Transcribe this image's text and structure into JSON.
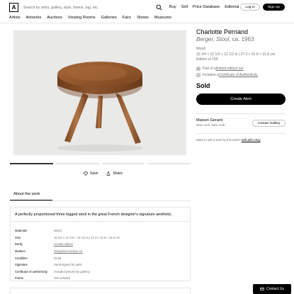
{
  "header": {
    "logo": "A",
    "search_placeholder": "Search by artist, gallery, style, theme, tag, etc.",
    "links": [
      "Buy",
      "Sell",
      "Price Database",
      "Editorial"
    ],
    "login": "Log In",
    "signup": "Sign Up"
  },
  "nav": [
    "Artists",
    "Artworks",
    "Auctions",
    "Viewing Rooms",
    "Galleries",
    "Fairs",
    "Shows",
    "Museums"
  ],
  "actions": {
    "save": "Save",
    "share": "Share"
  },
  "tabs": {
    "about": "About the work"
  },
  "details": {
    "description": "A perfectly proportioned three legged stool in the great French designer's signature aesthetic.",
    "rows": [
      {
        "key": "Materials",
        "value": "Wood"
      },
      {
        "key": "Size",
        "value": "10 3/4 × 12 1/2 × 12 1/2 in | 27.3 × 31.8 × 31.8 cm"
      },
      {
        "key": "Rarity",
        "value": "Limited edition"
      },
      {
        "key": "Medium",
        "value": "Design/Decorative Art"
      },
      {
        "key": "Condition",
        "value": "Good"
      },
      {
        "key": "Signature",
        "value": "Hand-signed by artist"
      },
      {
        "key": "Certificate of authenticity",
        "value": "Included (issued by gallery)"
      },
      {
        "key": "Frame",
        "value": "Not included"
      }
    ]
  },
  "sidebar": {
    "artist": "Charlotte Perriand",
    "title": "Berger, Stool",
    "date": ", ca. 1963",
    "material": "Wood",
    "size": "10 3/4 × 12 1/2 × 12 1/2 in | 27.3 × 31.8 × 31.8 cm",
    "edition": "Edition of 150",
    "feature1_prefix": "Part of a ",
    "feature1_link": "limited edition set",
    "feature2_prefix": "Includes a ",
    "feature2_link": "Certificate of Authenticity",
    "status": "Sold",
    "create_alert": "Create Alert",
    "gallery_name": "Maison Gerard",
    "gallery_location": "New York, New York",
    "contact_gallery": "Contact Gallery",
    "sell_prefix": "Want to sell a work by this artist? ",
    "sell_link": "Sell with Artsy"
  },
  "contact_us": "Contact Us",
  "colors": {
    "accent": "#000000",
    "muted": "#707070",
    "divider": "#e5e5e5",
    "stool": "#9a5a2c"
  }
}
